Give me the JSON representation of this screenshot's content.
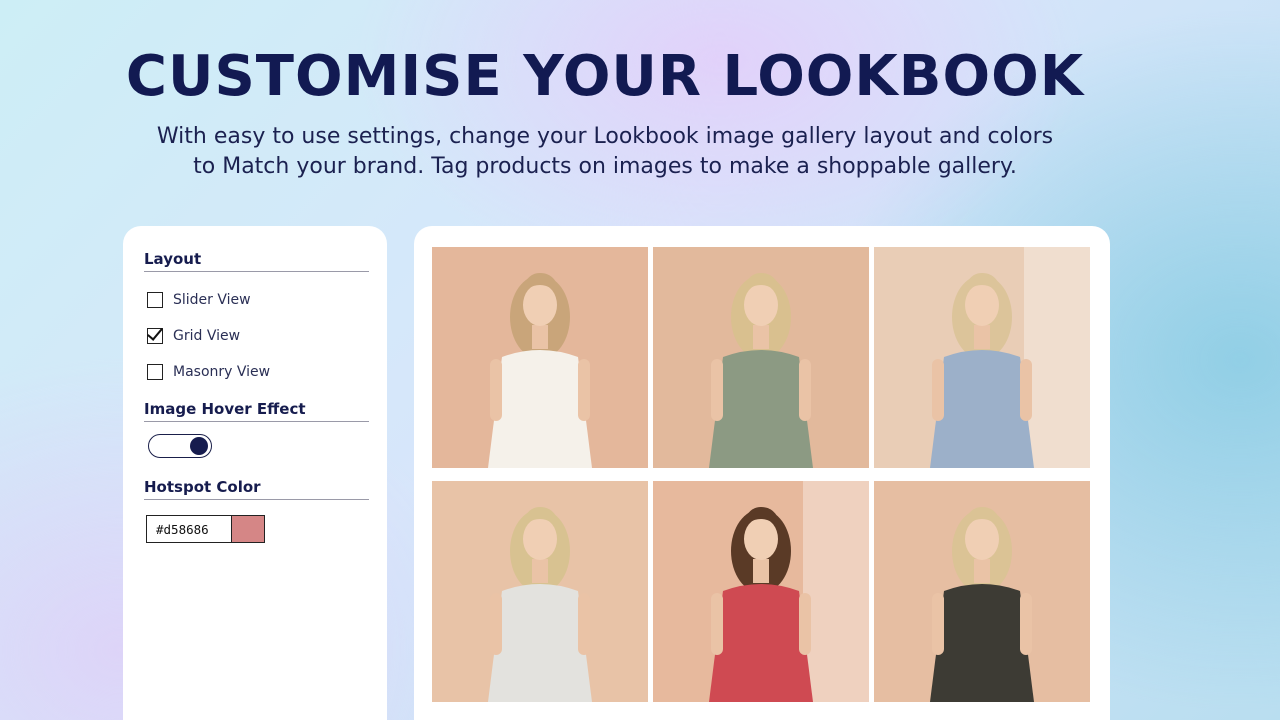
{
  "header": {
    "title": "CUSTOMISE YOUR LOOKBOOK",
    "subtitle_line1": "With easy to use settings, change your Lookbook image gallery layout and colors",
    "subtitle_line2": "to Match your brand. Tag products on images to make a shoppable gallery."
  },
  "settings": {
    "layout": {
      "title": "Layout",
      "options": [
        {
          "label": "Slider View",
          "checked": false
        },
        {
          "label": "Grid View",
          "checked": true
        },
        {
          "label": "Masonry View",
          "checked": false
        }
      ]
    },
    "hover": {
      "title": "Image Hover Effect",
      "enabled": true
    },
    "hotspot": {
      "title": "Hotspot Color",
      "value": "#d58686",
      "color": "#d58686"
    }
  },
  "gallery": {
    "layout": "grid",
    "columns": 3,
    "photos": [
      {
        "dress": "white-dress",
        "bg": "#e4b79b",
        "dress_color": "#f5f1ea",
        "hair": "#c9a57a"
      },
      {
        "dress": "sage-floral-dress",
        "bg": "#e2b99c",
        "dress_color": "#8c9a83",
        "hair": "#d9c08f"
      },
      {
        "dress": "blue-floral-dress",
        "bg": "#e9cdb6",
        "dress_color": "#9cb0c9",
        "hair": "#dcc49a"
      },
      {
        "dress": "white-print-dress",
        "bg": "#e8c3a7",
        "dress_color": "#e3e2de",
        "hair": "#d8c291"
      },
      {
        "dress": "red-floral-dress",
        "bg": "#e7b99d",
        "dress_color": "#cf4a52",
        "hair": "#5a3a26"
      },
      {
        "dress": "black-floral-dress",
        "bg": "#e6bea2",
        "dress_color": "#3d3b34",
        "hair": "#dbc395"
      }
    ]
  },
  "colors": {
    "brand_navy": "#121a52",
    "panel_bg": "#ffffff"
  }
}
